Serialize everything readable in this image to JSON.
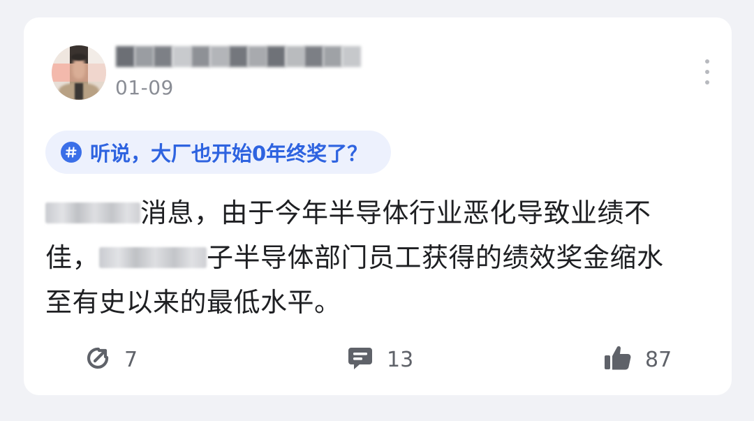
{
  "post": {
    "date": "01-09",
    "topic": {
      "label": "听说，大厂也开始0年终奖了？",
      "icon": "hashtag-icon"
    },
    "body": {
      "line1_after_blur": "消息，由于今年半导体行业恶化导致业绩不",
      "line2_before_blur": "佳，",
      "line2_after_blur": "子半导体部门员工获得的绩效奖金缩水",
      "line3": "至有史以来的最低水平。"
    },
    "actions": {
      "share": {
        "icon": "share-icon",
        "count": "7"
      },
      "comment": {
        "icon": "comment-icon",
        "count": "13"
      },
      "like": {
        "icon": "thumbs-up-icon",
        "count": "87"
      }
    }
  },
  "colors": {
    "page_background": "#f1f2f6",
    "card_background": "#ffffff",
    "topic_background": "#edf1fd",
    "topic_text": "#2e63e0",
    "body_text": "#1e1f22",
    "meta_text": "#8a8d95",
    "icon_color": "#5f6269"
  }
}
